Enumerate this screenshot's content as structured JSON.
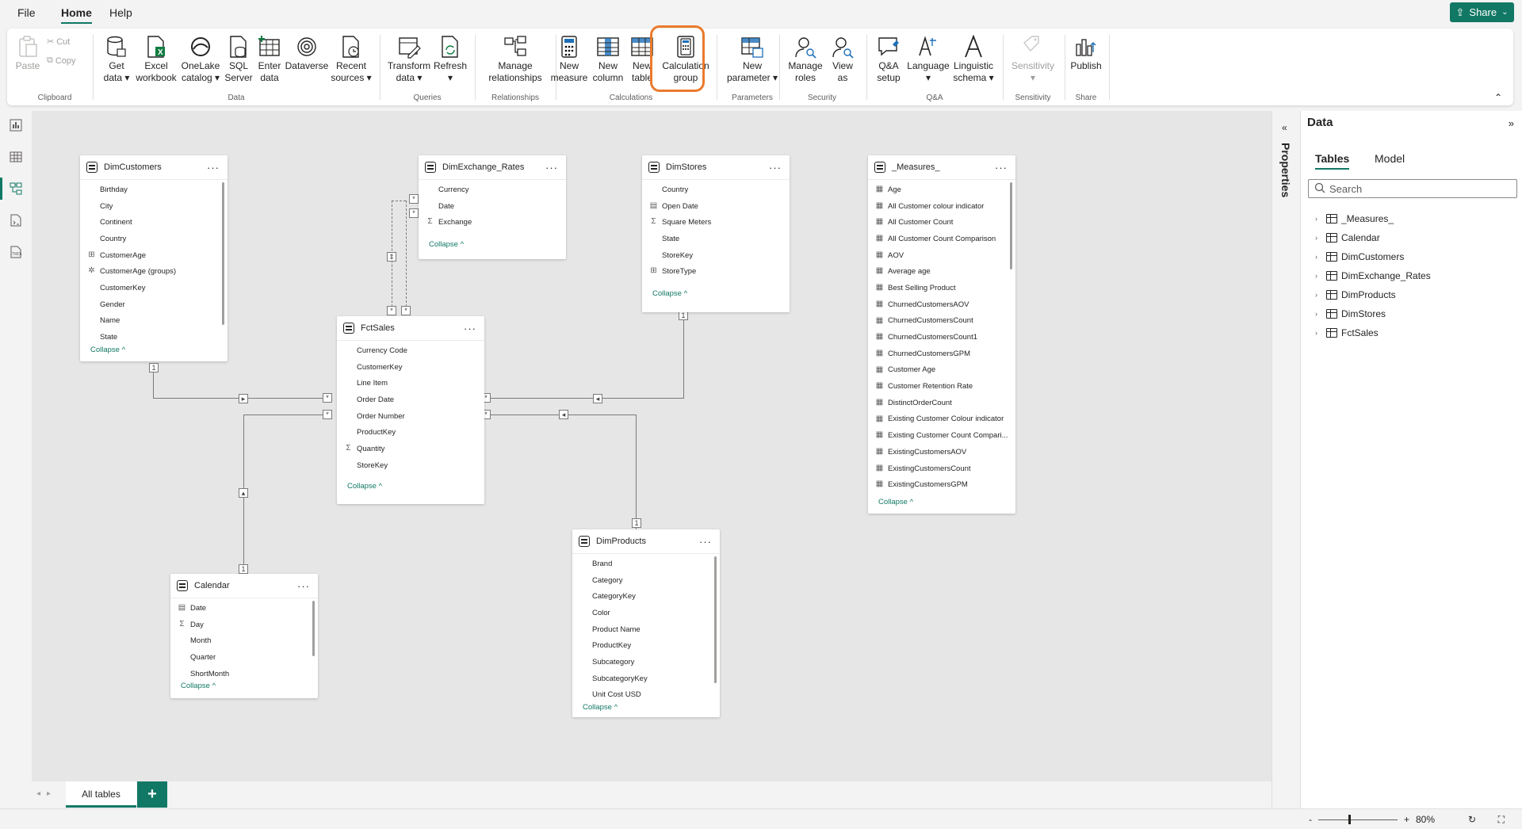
{
  "menu": {
    "file": "File",
    "home": "Home",
    "help": "Help",
    "share": "Share"
  },
  "ribbon": {
    "clipboard": {
      "paste": "Paste",
      "cut": "Cut",
      "copy": "Copy",
      "group": "Clipboard"
    },
    "data": {
      "get_data": "Get\ndata ▾",
      "excel": "Excel\nworkbook",
      "onelake": "OneLake\ncatalog ▾",
      "sql": "SQL\nServer",
      "enter": "Enter\ndata",
      "dataverse": "Dataverse",
      "recent": "Recent\nsources ▾",
      "group": "Data"
    },
    "queries": {
      "transform": "Transform\ndata ▾",
      "refresh": "Refresh\n▾",
      "group": "Queries"
    },
    "relationships": {
      "manage": "Manage\nrelationships",
      "group": "Relationships"
    },
    "calculations": {
      "new_measure": "New\nmeasure",
      "new_column": "New\ncolumn",
      "new_table": "New\ntable",
      "calc_group": "Calculation\ngroup",
      "group": "Calculations"
    },
    "parameters": {
      "new_param": "New\nparameter ▾",
      "group": "Parameters"
    },
    "security": {
      "manage_roles": "Manage\nroles",
      "view_as": "View\nas",
      "group": "Security"
    },
    "qa": {
      "setup": "Q&A\nsetup",
      "language": "Language\n▾",
      "schema": "Linguistic\nschema ▾",
      "group": "Q&A"
    },
    "sensitivity": {
      "label": "Sensitivity\n▾",
      "group": "Sensitivity"
    },
    "share": {
      "publish": "Publish",
      "group": "Share"
    }
  },
  "tables": {
    "dimcustomers": {
      "title": "DimCustomers",
      "fields": [
        "Birthday",
        "City",
        "Continent",
        "Country",
        "CustomerAge",
        "CustomerAge (groups)",
        "CustomerKey",
        "Gender",
        "Name",
        "State"
      ],
      "collapse": "Collapse ^"
    },
    "dimexchange": {
      "title": "DimExchange_Rates",
      "fields": [
        "Currency",
        "Date",
        "Exchange"
      ],
      "collapse": "Collapse ^"
    },
    "dimstores": {
      "title": "DimStores",
      "fields": [
        "Country",
        "Open Date",
        "Square Meters",
        "State",
        "StoreKey",
        "StoreType"
      ],
      "collapse": "Collapse ^"
    },
    "measures": {
      "title": "_Measures_",
      "fields": [
        "Age",
        "All Customer colour indicator",
        "All Customer Count",
        "All Customer Count Comparison",
        "AOV",
        "Average age",
        "Best Selling Product",
        "ChurnedCustomersAOV",
        "ChurnedCustomersCount",
        "ChurnedCustomersCount1",
        "ChurnedCustomersGPM",
        "Customer Age",
        "Customer Retention Rate",
        "DistinctOrderCount",
        "Existing Customer Colour indicator",
        "Existing Customer Count Compari...",
        "ExistingCustomersAOV",
        "ExistingCustomersCount",
        "ExistingCustomersGPM"
      ],
      "collapse": "Collapse ^"
    },
    "fctsales": {
      "title": "FctSales",
      "fields": [
        "Currency Code",
        "CustomerKey",
        "Line Item",
        "Order Date",
        "Order Number",
        "ProductKey",
        "Quantity",
        "StoreKey"
      ],
      "collapse": "Collapse ^"
    },
    "calendar": {
      "title": "Calendar",
      "fields": [
        "Date",
        "Day",
        "Month",
        "Quarter",
        "ShortMonth"
      ],
      "collapse": "Collapse ^"
    },
    "dimproducts": {
      "title": "DimProducts",
      "fields": [
        "Brand",
        "Category",
        "CategoryKey",
        "Color",
        "Product Name",
        "ProductKey",
        "Subcategory",
        "SubcategoryKey",
        "Unit Cost USD"
      ],
      "collapse": "Collapse ^"
    }
  },
  "markers": {
    "one": "1",
    "many": "*"
  },
  "bottom": {
    "tab": "All tables",
    "add": "+"
  },
  "properties": {
    "title": "Properties"
  },
  "data_pane": {
    "title": "Data",
    "tabs": [
      "Tables",
      "Model"
    ],
    "search_placeholder": "Search",
    "items": [
      "_Measures_",
      "Calendar",
      "DimCustomers",
      "DimExchange_Rates",
      "DimProducts",
      "DimStores",
      "FctSales"
    ]
  },
  "status": {
    "zoom": "80%",
    "minus": "-",
    "plus": "+"
  },
  "colors": {
    "accent": "#117865",
    "highlight": "#ea7a2c"
  }
}
